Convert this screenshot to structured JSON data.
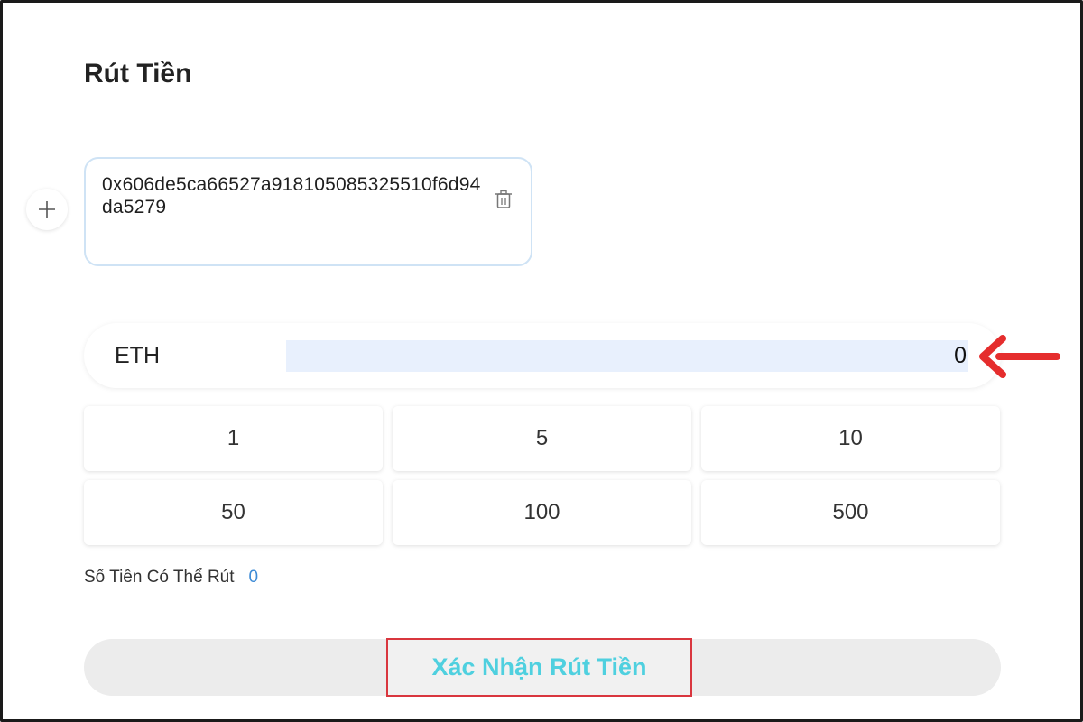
{
  "page": {
    "title": "Rút Tiền"
  },
  "address": {
    "value": "0x606de5ca66527a918105085325510f6d94da5279"
  },
  "amount": {
    "currency": "ETH",
    "value": "0"
  },
  "presets": [
    {
      "label": "1"
    },
    {
      "label": "5"
    },
    {
      "label": "10"
    },
    {
      "label": "50"
    },
    {
      "label": "100"
    },
    {
      "label": "500"
    }
  ],
  "balance": {
    "label": "Số Tiền Có Thể Rút",
    "value": "0"
  },
  "confirm": {
    "label": "Xác Nhận Rút Tiền"
  },
  "icons": {
    "add": "plus-icon",
    "delete": "trash-icon",
    "annotation": "arrow-left-icon"
  },
  "colors": {
    "input_highlight": "#e8f0fd",
    "balance_value": "#3d8bd6",
    "confirm_text": "#4fd0df",
    "annotation_red": "#e52d2d",
    "address_border": "#cfe3f5"
  }
}
